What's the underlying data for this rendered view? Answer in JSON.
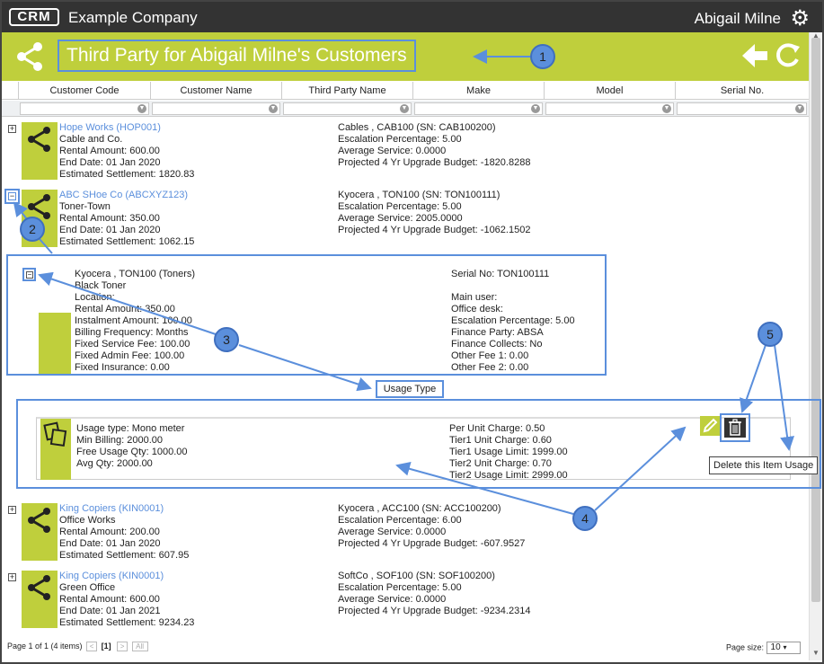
{
  "app": {
    "logo": "CRM",
    "company": "Example Company",
    "user": "Abigail Milne",
    "icons": {
      "settings": "gear-icon",
      "share": "share-icon",
      "back": "arrow-left-icon",
      "refresh": "refresh-icon"
    }
  },
  "page": {
    "title": "Third Party for Abigail Milne's Customers"
  },
  "columns": [
    "Customer Code",
    "Customer Name",
    "Third Party Name",
    "Make",
    "Model",
    "Serial No."
  ],
  "records": [
    {
      "expander": "+",
      "name": "Hope Works (HOP001)",
      "customer": "Cable and Co.",
      "rental": "Rental Amount: 600.00",
      "end": "End Date: 01 Jan 2020",
      "settlement": "Estimated Settlement: 1820.83",
      "product": "Cables , CAB100 (SN: CAB100200)",
      "escalation": "Escalation Percentage: 5.00",
      "service": "Average Service: 0.0000",
      "budget": "Projected 4 Yr Upgrade Budget: -1820.8288"
    },
    {
      "expander": "−",
      "name": "ABC SHoe Co (ABCXYZ123)",
      "customer": "Toner-Town",
      "rental": "Rental Amount: 350.00",
      "end": "End Date: 01 Jan 2020",
      "settlement": "Estimated Settlement: 1062.15",
      "product": "Kyocera , TON100 (SN: TON100111)",
      "escalation": "Escalation Percentage: 5.00",
      "service": "Average Service: 2005.0000",
      "budget": "Projected 4 Yr Upgrade Budget: -1062.1502"
    },
    {
      "expander": "+",
      "name": "King Copiers (KIN0001)",
      "customer": "Office Works",
      "rental": "Rental Amount: 200.00",
      "end": "End Date: 01 Jan 2020",
      "settlement": "Estimated Settlement: 607.95",
      "product": "Kyocera , ACC100 (SN: ACC100200)",
      "escalation": "Escalation Percentage: 6.00",
      "service": "Average Service: 0.0000",
      "budget": "Projected 4 Yr Upgrade Budget: -607.9527"
    },
    {
      "expander": "+",
      "name": "King Copiers (KIN0001)",
      "customer": "Green Office",
      "rental": "Rental Amount: 600.00",
      "end": "End Date: 01 Jan 2021",
      "settlement": "Estimated Settlement: 9234.23",
      "product": "SoftCo , SOF100 (SN: SOF100200)",
      "escalation": "Escalation Percentage: 5.00",
      "service": "Average Service: 0.0000",
      "budget": "Projected 4 Yr Upgrade Budget: -9234.2314"
    }
  ],
  "detail": {
    "expander": "−",
    "left": [
      "Kyocera , TON100 (Toners)",
      "Black Toner",
      "Location:",
      "Rental Amount: 350.00",
      "Instalment Amount: 100.00",
      "Billing Frequency: Months",
      "Fixed Service Fee: 100.00",
      "Fixed Admin Fee: 100.00",
      "Fixed Insurance: 0.00"
    ],
    "right": [
      "Serial No: TON100111",
      "",
      "Main user:",
      "Office desk:",
      "Escalation Percentage: 5.00",
      "Finance Party: ABSA",
      "Finance Collects: No",
      "Other Fee 1: 0.00",
      "Other Fee 2: 0.00"
    ]
  },
  "usage": {
    "tab": "Usage Type",
    "left": [
      "Usage type: Mono meter",
      "Min Billing: 2000.00",
      "Free Usage Qty: 1000.00",
      "Avg Qty: 2000.00"
    ],
    "right": [
      "Per Unit Charge: 0.50",
      "Tier1 Unit Charge: 0.60",
      "Tier1 Usage Limit: 1999.00",
      "Tier2 Unit Charge: 0.70",
      "Tier2 Usage Limit: 2999.00"
    ],
    "tooltip": "Delete this Item Usage",
    "icons": {
      "usage": "copy-pages-icon",
      "edit": "pencil-icon",
      "delete": "trash-icon"
    }
  },
  "callouts": [
    "1",
    "2",
    "3",
    "4",
    "5"
  ],
  "pager": {
    "info": "Page 1 of 1 (4 items)",
    "prev": "<",
    "current": "[1]",
    "next": ">",
    "all": "All",
    "size_label": "Page size:",
    "size_value": "10"
  },
  "colors": {
    "accent": "#bfcf3c",
    "topbar": "#333333",
    "annotation": "#5b8fdc",
    "link": "#5b8fdc"
  }
}
